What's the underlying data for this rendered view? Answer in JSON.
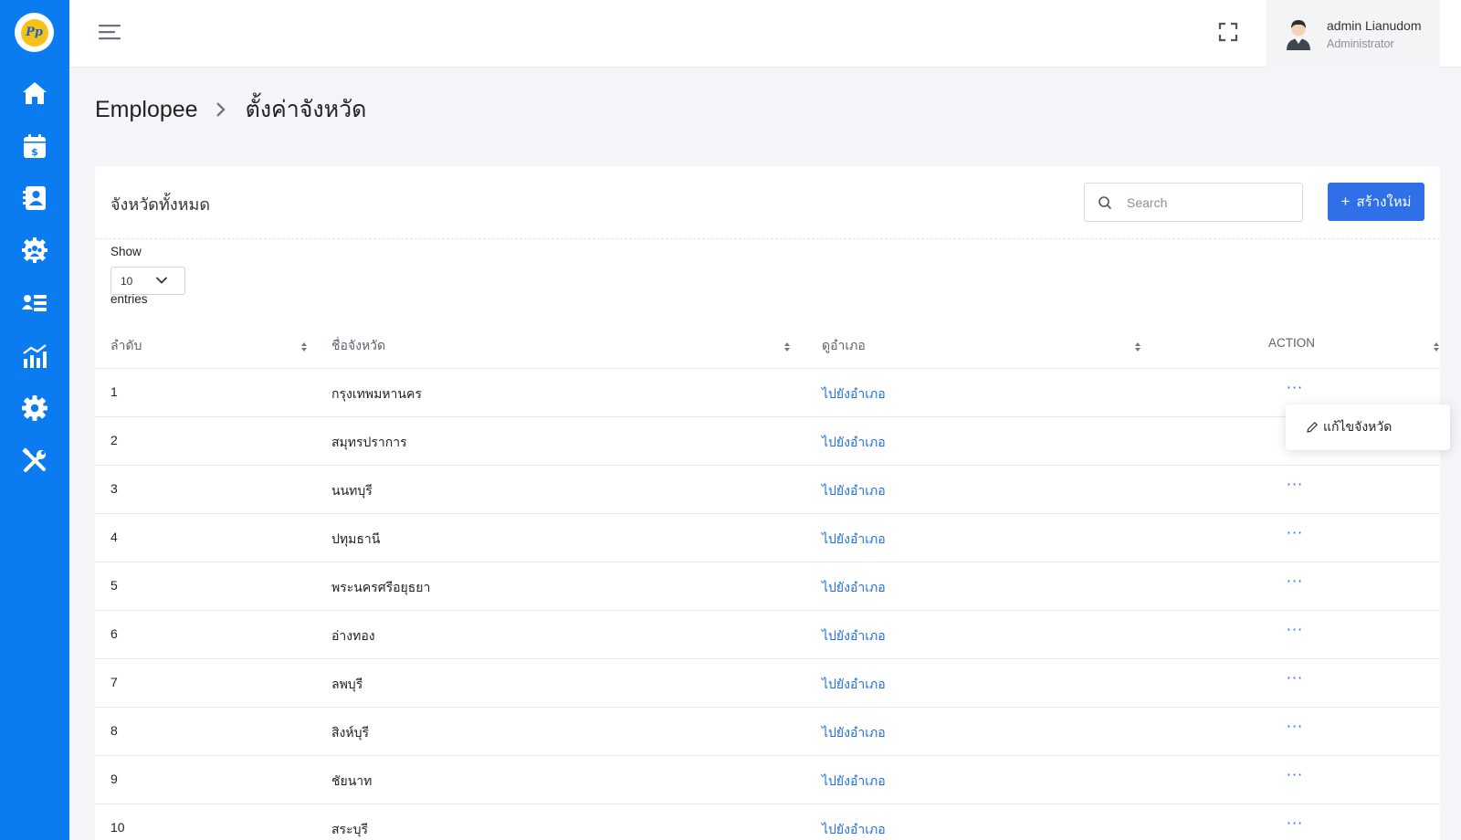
{
  "sidebar": {
    "logo_text": "Pp",
    "items": [
      {
        "icon": "home-icon"
      },
      {
        "icon": "calendar-dollar-icon"
      },
      {
        "icon": "contact-book-icon"
      },
      {
        "icon": "team-gear-icon"
      },
      {
        "icon": "user-list-icon"
      },
      {
        "icon": "bar-chart-icon"
      },
      {
        "icon": "settings-gear-icon"
      },
      {
        "icon": "tools-icon"
      }
    ],
    "colors": {
      "background": "#0a7cf0",
      "logo_yellow": "#f6c21a"
    }
  },
  "header": {
    "user_name": "admin Lianudom",
    "user_role": "Administrator"
  },
  "breadcrumb": {
    "parent": "Emplopee",
    "current": "ตั้งค่าจังหวัด"
  },
  "card": {
    "title": "จังหวัดทั้งหมด",
    "search_placeholder": "Search",
    "create_label": "สร้างใหม่",
    "create_plus": "+"
  },
  "length_menu": {
    "show_label": "Show",
    "value": "10",
    "entries_label": "entries"
  },
  "table": {
    "columns": [
      "ลำดับ",
      "ชื่อจังหวัด",
      "ดูอำเภอ",
      "ACTION"
    ],
    "link_label": "ไปยังอำเภอ",
    "action_dots": "···",
    "rows": [
      {
        "no": "1",
        "name": "กรุงเทพมหานคร"
      },
      {
        "no": "2",
        "name": "สมุทรปราการ"
      },
      {
        "no": "3",
        "name": "นนทบุรี"
      },
      {
        "no": "4",
        "name": "ปทุมธานี"
      },
      {
        "no": "5",
        "name": "พระนครศรีอยุธยา"
      },
      {
        "no": "6",
        "name": "อ่างทอง"
      },
      {
        "no": "7",
        "name": "ลพบุรี"
      },
      {
        "no": "8",
        "name": "สิงห์บุรี"
      },
      {
        "no": "9",
        "name": "ชัยนาท"
      },
      {
        "no": "10",
        "name": "สระบุรี"
      }
    ]
  },
  "dropdown": {
    "edit_label": "แก้ไขจังหวัด"
  },
  "colors": {
    "primary": "#2f6fe8",
    "link": "#1f6fe0"
  }
}
